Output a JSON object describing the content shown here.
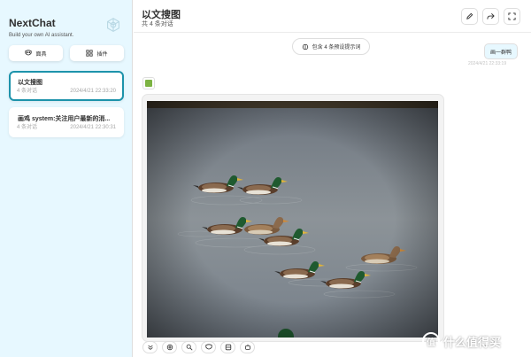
{
  "sidebar": {
    "brand_title": "NextChat",
    "brand_subtitle": "Build your own AI assistant.",
    "mask_button": "面具",
    "plugin_button": "插件",
    "chats": [
      {
        "title": "以文搜图",
        "count": "4 条对话",
        "date": "2024/4/21 22:33:20",
        "selected": true
      },
      {
        "title": "画鸡 system:关注用户最新的消...",
        "count": "4 条对话",
        "date": "2024/4/21 22:30:31",
        "selected": false
      }
    ]
  },
  "header": {
    "title": "以文搜图",
    "subtitle": "共 4 条对话"
  },
  "chat": {
    "prompt_pill": "包含 4 条预设提示词",
    "user_message": "画一群鸭",
    "user_date": "2024/4/21 22:33:19"
  },
  "watermark": {
    "logo": "值",
    "text": "什么值得买"
  },
  "icons": {
    "brand": "openai-logo-icon",
    "mask": "mask-icon",
    "plugin": "plugin-grid-icon",
    "edit": "edit-icon",
    "share": "share-icon",
    "fullscreen": "fullscreen-icon",
    "brain": "brain-icon"
  }
}
